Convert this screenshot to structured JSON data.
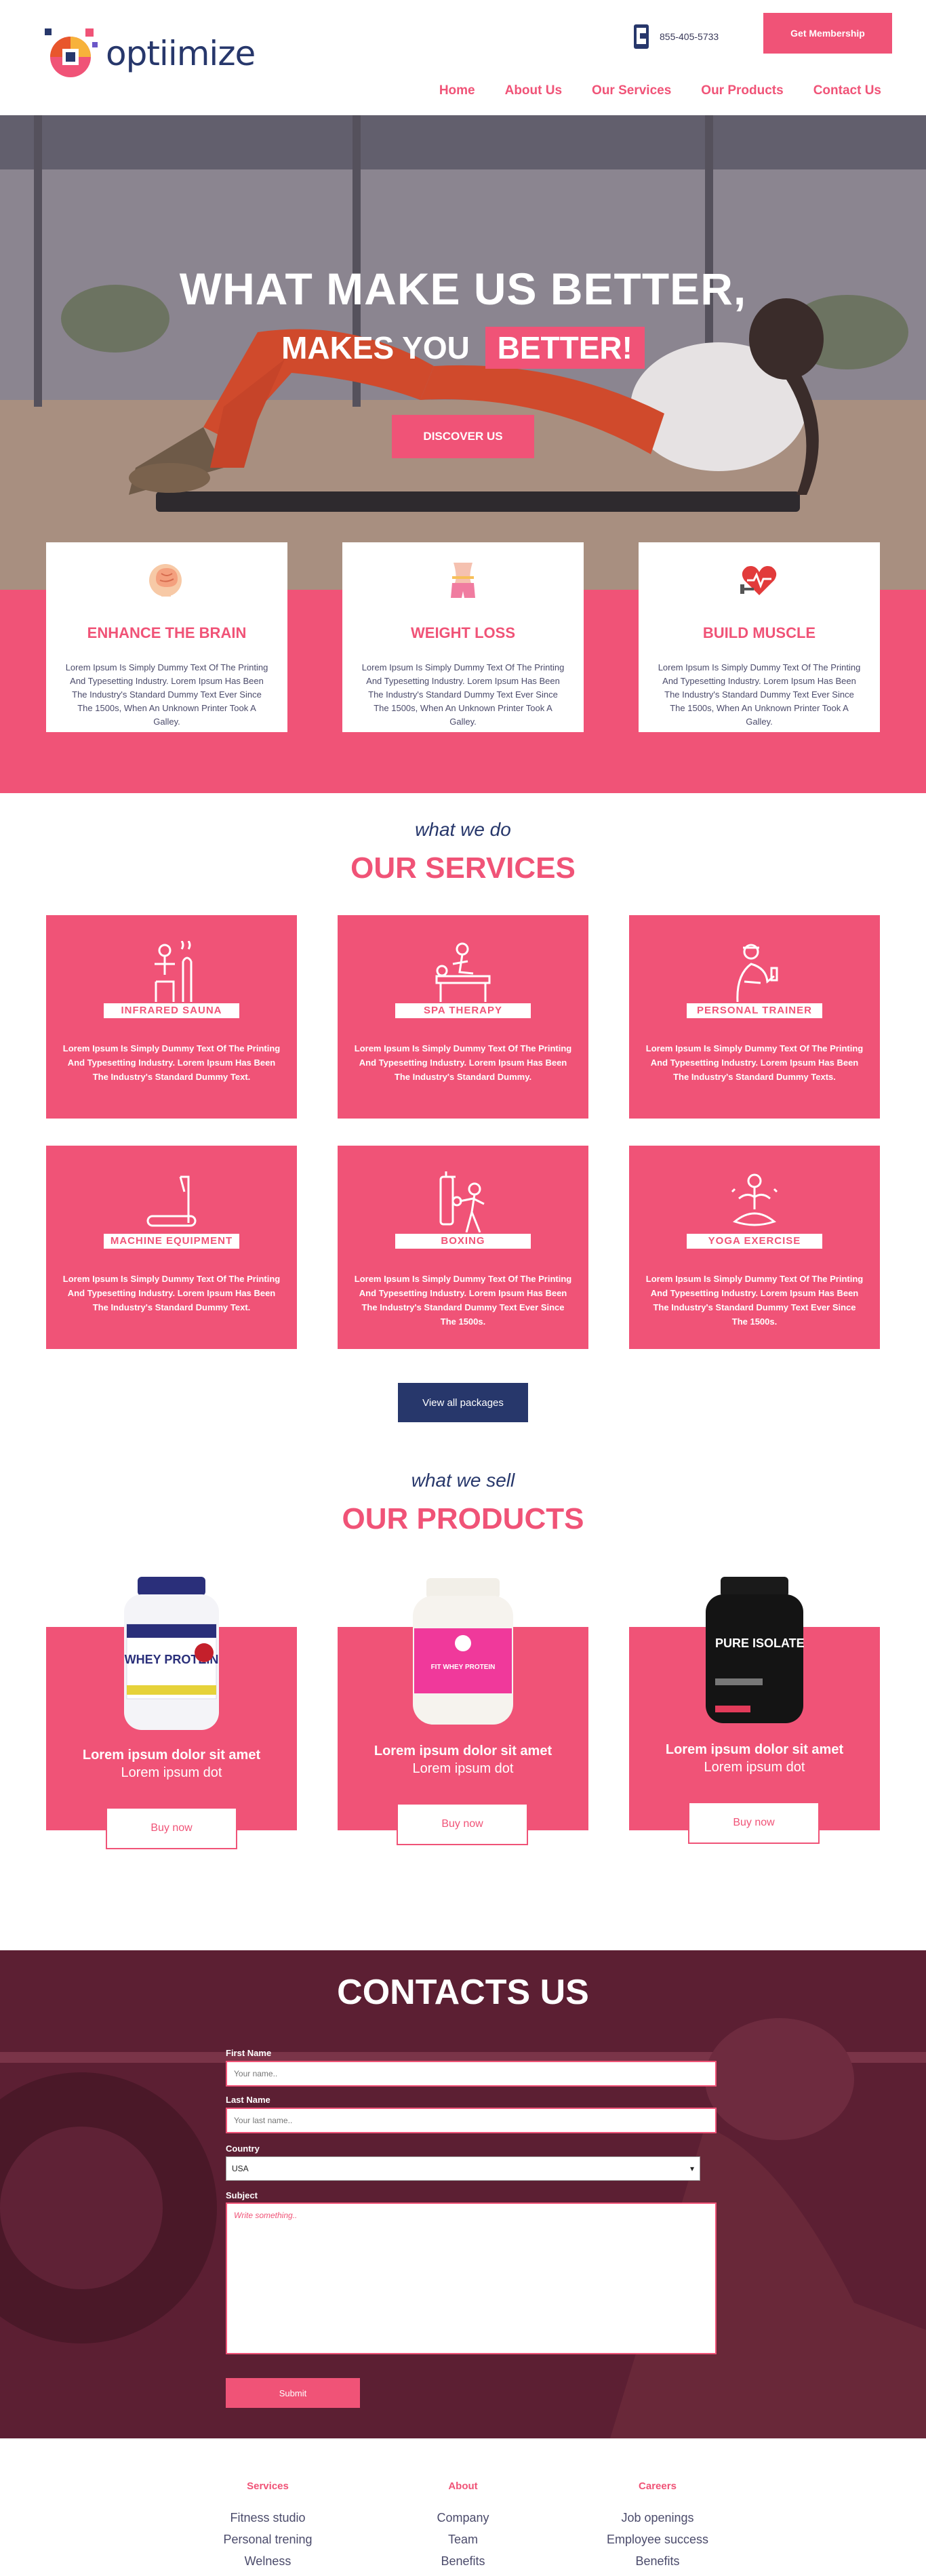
{
  "header": {
    "logo_text": "optiimize",
    "phone": "855-405-5733",
    "membership_label": "Get Membership",
    "nav": [
      "Home",
      "About Us",
      "Our Services",
      "Our Products",
      "Contact Us"
    ]
  },
  "hero": {
    "title": "WHAT MAKE US BETTER,",
    "subtitle_prefix": "MAKES YOU",
    "subtitle_highlight": "BETTER!",
    "cta": "DISCOVER US"
  },
  "features": [
    {
      "icon": "brain-icon",
      "title": "ENHANCE THE BRAIN",
      "text": "Lorem Ipsum Is Simply Dummy Text Of The Printing And Typesetting Industry. Lorem Ipsum Has Been The Industry's Standard Dummy Text Ever Since The 1500s, When An Unknown Printer Took A Galley."
    },
    {
      "icon": "waist-icon",
      "title": "WEIGHT LOSS",
      "text": "Lorem Ipsum Is Simply Dummy Text Of The Printing And Typesetting Industry. Lorem Ipsum Has Been The Industry's Standard Dummy Text Ever Since The 1500s, When An Unknown Printer Took A Galley."
    },
    {
      "icon": "heart-dumbbell-icon",
      "title": "BUILD MUSCLE",
      "text": "Lorem Ipsum Is Simply Dummy Text Of The Printing And Typesetting Industry. Lorem Ipsum Has Been The Industry's Standard Dummy Text Ever Since The 1500s, When An Unknown Printer Took A Galley."
    }
  ],
  "services": {
    "pre": "what we do",
    "title": "OUR SERVICES",
    "items": [
      {
        "icon": "sauna-icon",
        "label": "INFRARED SAUNA",
        "text": "Lorem Ipsum Is Simply Dummy Text Of The Printing And Typesetting Industry. Lorem Ipsum Has Been The Industry's Standard Dummy Text."
      },
      {
        "icon": "massage-icon",
        "label": "SPA THERAPY",
        "text": "Lorem Ipsum Is Simply Dummy Text Of The Printing And Typesetting Industry. Lorem Ipsum Has Been The Industry's Standard Dummy."
      },
      {
        "icon": "trainer-icon",
        "label": "PERSONAL TRAINER",
        "text": "Lorem Ipsum Is Simply Dummy Text Of The Printing And Typesetting Industry. Lorem Ipsum Has Been The Industry's Standard Dummy Texts."
      },
      {
        "icon": "treadmill-icon",
        "label": "MACHINE EQUIPMENT",
        "text": "Lorem Ipsum Is Simply Dummy Text Of The Printing And Typesetting Industry. Lorem Ipsum Has Been The Industry's Standard Dummy Text."
      },
      {
        "icon": "boxing-icon",
        "label": "BOXING",
        "text": "Lorem Ipsum Is Simply Dummy Text Of The Printing And Typesetting Industry. Lorem Ipsum Has Been The Industry's Standard Dummy Text Ever Since The 1500s."
      },
      {
        "icon": "yoga-icon",
        "label": "YOGA EXERCISE",
        "text": "Lorem Ipsum Is Simply Dummy Text Of The Printing And Typesetting Industry. Lorem Ipsum Has Been The Industry's Standard Dummy Text Ever Since The 1500s."
      }
    ],
    "view_all": "View all packages"
  },
  "products": {
    "pre": "what we sell",
    "title": "OUR PRODUCTS",
    "items": [
      {
        "image": "whey-protein-tub",
        "name": "Lorem ipsum dolor sit amet",
        "sub": "Lorem ipsum dot",
        "buy": "Buy now",
        "jar_label": "WHEY PROTEIN"
      },
      {
        "image": "pink-whey-tub",
        "name": "Lorem ipsum dolor sit amet",
        "sub": "Lorem ipsum dot",
        "buy": "Buy now",
        "jar_label": "FIT WHEY PROTEIN"
      },
      {
        "image": "pure-isolate-tub",
        "name": "Lorem ipsum dolor sit amet",
        "sub": "Lorem ipsum dot",
        "buy": "Buy now",
        "jar_label": "PURE ISOLATE"
      }
    ]
  },
  "contact": {
    "title": "CONTACTS US",
    "first_name_label": "First Name",
    "first_name_placeholder": "Your name..",
    "last_name_label": "Last Name",
    "last_name_placeholder": "Your last name..",
    "country_label": "Country",
    "country_value": "USA",
    "subject_label": "Subject",
    "subject_placeholder": "Write something..",
    "submit": "Submit"
  },
  "footer": {
    "columns": [
      {
        "title": "Services",
        "links": [
          "Fitness studio",
          "Personal trening",
          "Welness"
        ]
      },
      {
        "title": "About",
        "links": [
          "Company",
          "Team",
          "Benefits"
        ]
      },
      {
        "title": "Careers",
        "links": [
          "Job openings",
          "Employee success",
          "Benefits"
        ]
      }
    ]
  },
  "colors": {
    "accent": "#f05377",
    "navy": "#27376b",
    "contact_bg": "#5c1f33"
  }
}
